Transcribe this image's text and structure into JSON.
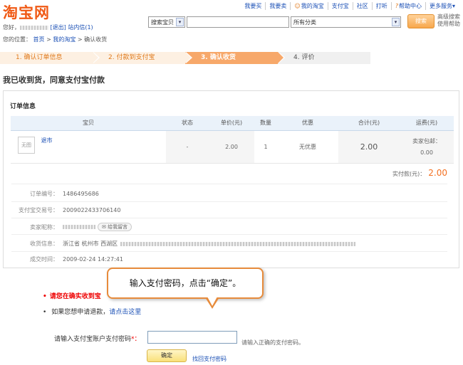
{
  "header": {
    "logo": "淘宝网",
    "nav": [
      "我要买",
      "我要卖",
      "我的淘宝",
      "支付宝",
      "社区",
      "打听",
      "帮助中心",
      "更多服务"
    ],
    "greeting_prefix": "您好，",
    "logout": "[退出]",
    "messages": "站内信(1)",
    "crumb_label": "您的位置：",
    "crumb_home": "首页",
    "crumb_mytaobao": "我的淘宝",
    "crumb_current": "确认收货"
  },
  "search": {
    "type_value": "搜索宝贝",
    "category_value": "所有分类",
    "button": "搜索",
    "advanced": "高级搜索",
    "help": "使用帮助"
  },
  "steps": [
    "1. 确认订单信息",
    "2. 付款到支付宝",
    "3. 确认收货",
    "4. 评价"
  ],
  "page_title": "我已收到货，同意支付宝付款",
  "order": {
    "section_title": "订单信息",
    "columns": [
      "宝贝",
      "状态",
      "单价(元)",
      "数量",
      "优惠",
      "合计(元)",
      "运费(元)"
    ],
    "item": {
      "thumb": "无图",
      "name": "退市",
      "status": "-",
      "price": "2.00",
      "qty": "1",
      "discount": "无优惠",
      "subtotal": "2.00",
      "shipping_label": "卖家包邮：",
      "shipping": "0.00"
    },
    "total_label": "实付款(元)：",
    "total": "2.00"
  },
  "details": {
    "order_no_label": "订单编号：",
    "order_no": "1486495686",
    "alipay_no_label": "支付宝交易号：",
    "alipay_no": "2009022433706140",
    "seller_label": "卖家昵称：",
    "chat": "给我留言",
    "address_label": "收货信息：",
    "address": "浙江省 杭州市 西湖区",
    "time_label": "成交时间：",
    "time": "2009-02-24 14:27:41"
  },
  "confirm": {
    "warning": "请您在确实收到宝",
    "refund_text": "如果您想申请退款，",
    "refund_link": "请点击这里",
    "tooltip": "输入支付密码，点击“确定”。",
    "pw_label": "请输入支付宝账户支付密码",
    "pw_star": "*：",
    "pw_hint": "请输入正确的支付密码。",
    "ok_button": "确定",
    "find_pw": "找回支付密码"
  }
}
